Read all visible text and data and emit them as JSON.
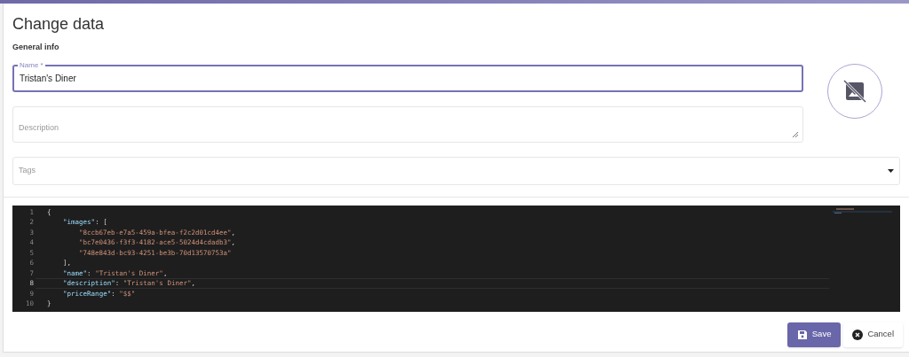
{
  "dialog": {
    "title": "Change data",
    "section": "General info"
  },
  "fields": {
    "name": {
      "label": "Name *",
      "value": "Tristan's Diner",
      "focused": true
    },
    "description": {
      "placeholder": "Description"
    },
    "tags": {
      "placeholder": "Tags"
    }
  },
  "editor": {
    "lines": [
      {
        "number": "1",
        "current": false,
        "tokens": [
          {
            "kind": "punct",
            "text": "{"
          }
        ]
      },
      {
        "number": "2",
        "current": false,
        "tokens": [
          {
            "kind": "key",
            "text": "\"images\""
          },
          {
            "kind": "punct",
            "text": ": ["
          }
        ]
      },
      {
        "number": "3",
        "current": false,
        "tokens": [
          {
            "kind": "string",
            "text": "\"8ccb67eb-e7a5-459a-bfea-f2c2d01cd4ee\""
          },
          {
            "kind": "punct",
            "text": ","
          }
        ]
      },
      {
        "number": "4",
        "current": false,
        "tokens": [
          {
            "kind": "string",
            "text": "\"bc7e0436-f3f3-4182-ace5-5024d4cdadb3\""
          },
          {
            "kind": "punct",
            "text": ","
          }
        ]
      },
      {
        "number": "5",
        "current": false,
        "tokens": [
          {
            "kind": "string",
            "text": "\"748e843d-bc93-4251-be3b-70d13570753a\""
          }
        ]
      },
      {
        "number": "6",
        "current": false,
        "tokens": [
          {
            "kind": "punct",
            "text": "],"
          }
        ]
      },
      {
        "number": "7",
        "current": false,
        "tokens": [
          {
            "kind": "key",
            "text": "\"name\""
          },
          {
            "kind": "punct",
            "text": ": "
          },
          {
            "kind": "string",
            "text": "\"Tristan's Diner\""
          },
          {
            "kind": "punct",
            "text": ","
          }
        ]
      },
      {
        "number": "8",
        "current": true,
        "tokens": [
          {
            "kind": "key",
            "text": "\"description\""
          },
          {
            "kind": "punct",
            "text": ": "
          },
          {
            "kind": "string",
            "text": "\"Tristan's Diner\""
          },
          {
            "kind": "punct",
            "text": ","
          }
        ]
      },
      {
        "number": "9",
        "current": false,
        "tokens": [
          {
            "kind": "key",
            "text": "\"priceRange\""
          },
          {
            "kind": "punct",
            "text": ": "
          },
          {
            "kind": "string",
            "text": "\"$$\""
          }
        ]
      },
      {
        "number": "10",
        "current": false,
        "tokens": [
          {
            "kind": "punct",
            "text": "}"
          }
        ]
      }
    ]
  },
  "buttons": [
    {
      "kind": "save",
      "label": "Save"
    },
    {
      "kind": "cancel",
      "label": "Cancel"
    }
  ]
}
